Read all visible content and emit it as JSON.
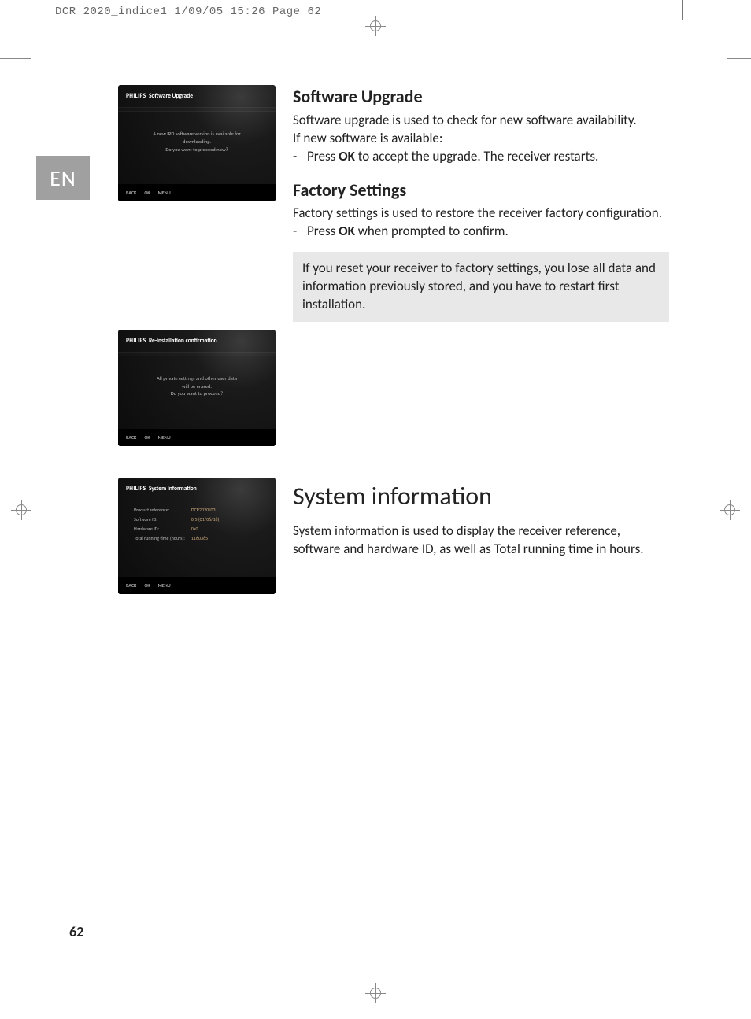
{
  "print_header": "DCR 2020_indice1  1/09/05  15:26  Page 62",
  "language_tab": "EN",
  "page_number": "62",
  "screens": {
    "upgrade": {
      "brand": "PHILIPS",
      "title": "Software Upgrade",
      "msg_line1": "A new IRD software version is available for",
      "msg_line2": "downloading.",
      "msg_line3": "Do you want to proceed now?",
      "btn_back": "BACK",
      "btn_ok": "OK",
      "btn_menu": "MENU"
    },
    "reinstall": {
      "brand": "PHILIPS",
      "title": "Re-installation confirmation",
      "msg_line1": "All private settings and other user data",
      "msg_line2": "will be erased.",
      "msg_line3": "Do you want to proceed?",
      "btn_back": "BACK",
      "btn_ok": "OK",
      "btn_menu": "MENU"
    },
    "sysinfo": {
      "brand": "PHILIPS",
      "title": "System information",
      "rows": {
        "r0l": "Product reference:",
        "r0v": "DCR2020/03",
        "r1l": "Software ID:",
        "r1v": "0.5 (01/06/18)",
        "r2l": "Hardware ID:",
        "r2v": "0x0",
        "r3l": "Total running time (hours):",
        "r3v": "1160385"
      },
      "btn_back": "BACK",
      "btn_ok": "OK",
      "btn_menu": "MENU"
    }
  },
  "sections": {
    "software_upgrade": {
      "heading": "Software Upgrade",
      "p1": "Software upgrade is used to check for new software availability.",
      "p2": "If new software is available:",
      "li_pre": "Press ",
      "li_bold": "OK",
      "li_post": " to accept the upgrade. The receiver restarts."
    },
    "factory_settings": {
      "heading": "Factory Settings",
      "p1": "Factory settings is used to restore the receiver factory configuration.",
      "li_pre": "Press ",
      "li_bold": "OK",
      "li_post": " when prompted to confirm.",
      "note": "If you reset your receiver to factory settings, you lose all data and information previously stored, and you have to restart first installation."
    },
    "system_information": {
      "heading": "System information",
      "p1": "System information is used to display the receiver reference, software and hardware ID, as well as Total running time in hours."
    }
  }
}
